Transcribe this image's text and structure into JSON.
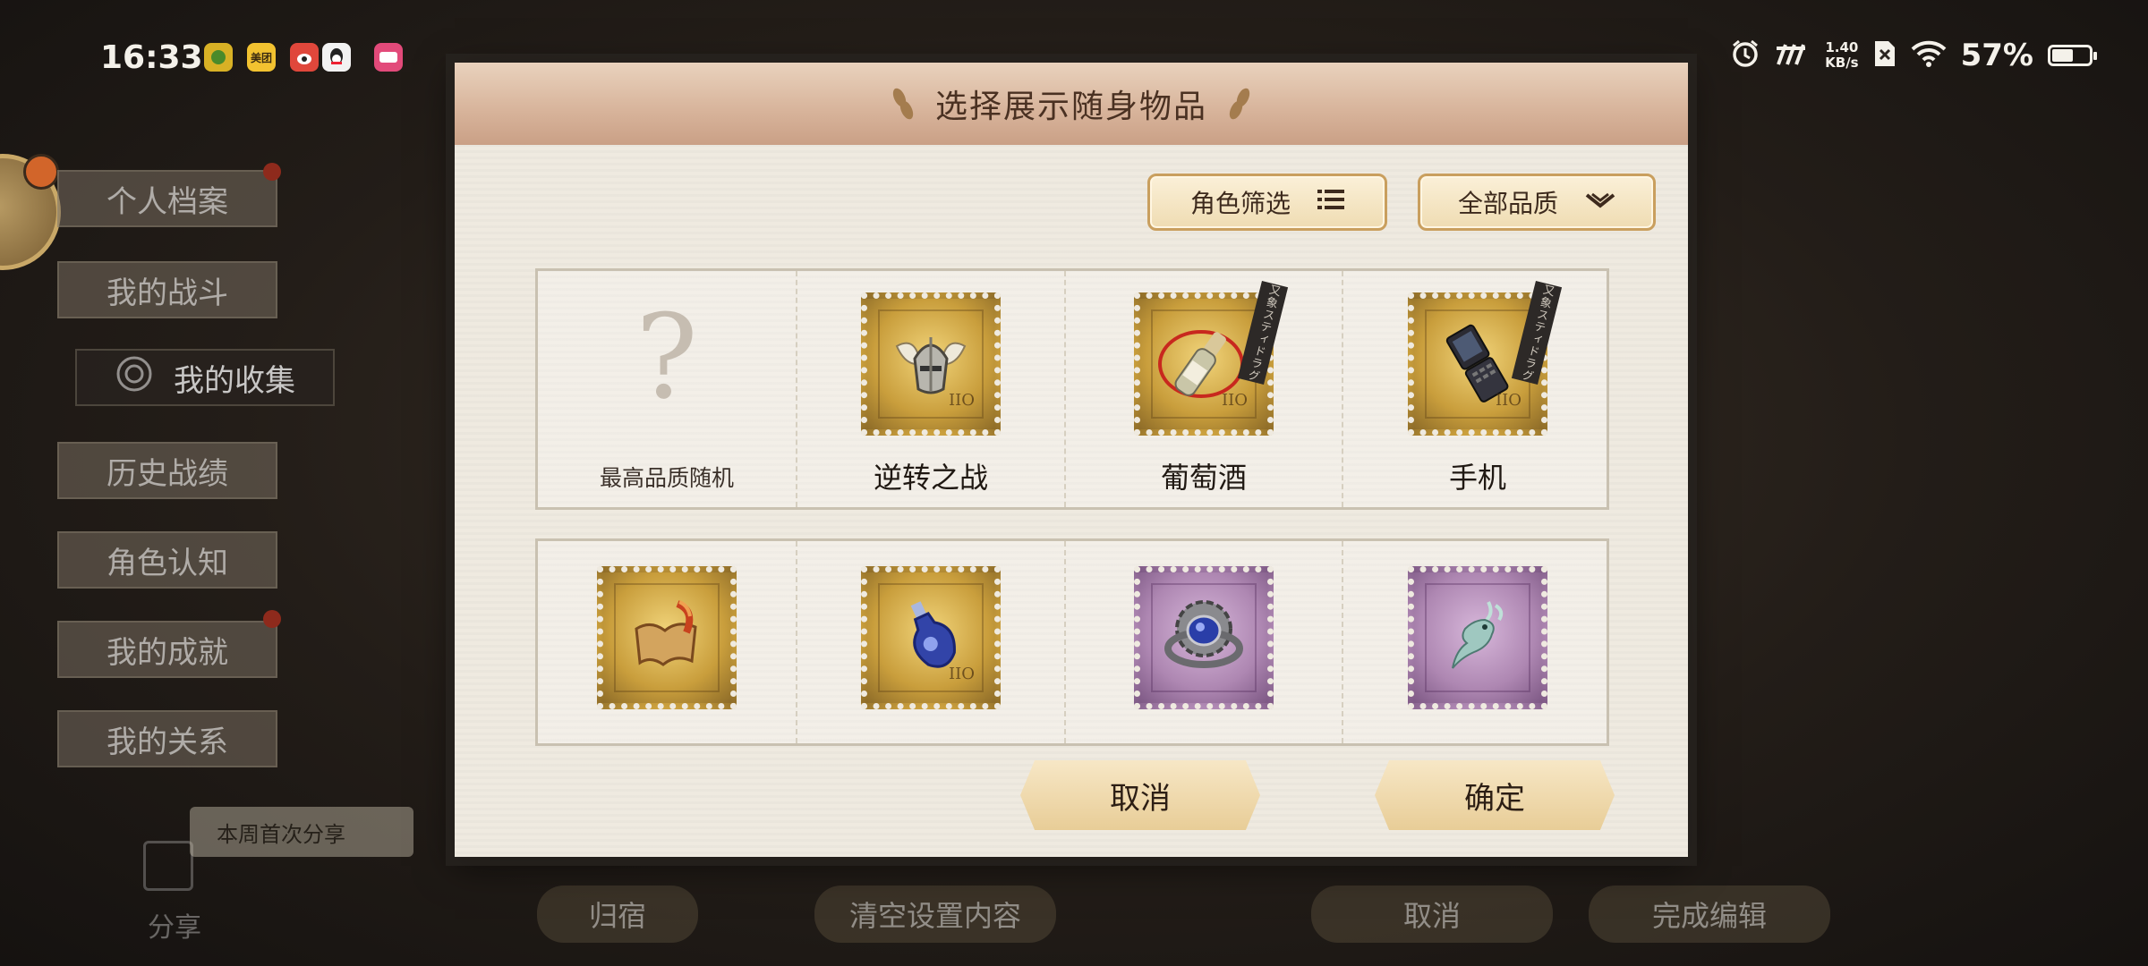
{
  "status_bar": {
    "time": "16:33",
    "apps": [
      {
        "icon": "app-icon-green",
        "label": "",
        "color": "#d8b125"
      },
      {
        "icon": "meituan-icon",
        "label": "美团",
        "color": "#f2c230"
      },
      {
        "icon": "weibo-icon",
        "label": "",
        "color": "#e0473b"
      },
      {
        "icon": "qq-icon",
        "label": "",
        "color": "#f2f2f2"
      },
      {
        "icon": "app-icon-pink",
        "label": "",
        "color": "#e24a7a"
      }
    ],
    "net_speed_value": "1.40",
    "net_speed_unit": "KB/s",
    "battery_percent": "57%",
    "battery_level": 0.57
  },
  "side_menu": {
    "items": [
      {
        "label": "个人档案",
        "badge": true
      },
      {
        "label": "我的战斗",
        "badge": false
      },
      {
        "label": "我的收集",
        "active": true
      },
      {
        "label": "历史战绩",
        "badge": false
      },
      {
        "label": "角色认知",
        "badge": false
      },
      {
        "label": "我的成就",
        "badge": true
      },
      {
        "label": "我的关系",
        "badge": false
      }
    ],
    "share_tag": "本周首次分享",
    "share_label": "分享"
  },
  "bottom_bar": {
    "return_label": "归宿",
    "clear_label": "清空设置内容",
    "cancel_label": "取消",
    "finish_label": "完成编辑"
  },
  "dialog": {
    "title": "选择展示随身物品",
    "filter_role": "角色筛选",
    "filter_quality": "全部品质",
    "items_row1": [
      {
        "label": "最高品质随机",
        "type": "random"
      },
      {
        "label": "逆转之战",
        "stamp": "gold",
        "icon": "winged-helmet-icon",
        "num": "IIO"
      },
      {
        "label": "葡萄酒",
        "stamp": "gold",
        "icon": "wine-bottle-icon",
        "num": "IIO",
        "ribbon": "又象スティドラグ"
      },
      {
        "label": "手机",
        "stamp": "gold",
        "icon": "flip-phone-icon",
        "num": "IIO",
        "ribbon": "又象スティドラグ"
      }
    ],
    "items_row2": [
      {
        "stamp": "gold",
        "icon": "scroll-icon",
        "num": ""
      },
      {
        "stamp": "gold",
        "icon": "potion-bottle-icon",
        "num": "IIO"
      },
      {
        "stamp": "purple",
        "icon": "gear-ring-icon",
        "num": ""
      },
      {
        "stamp": "purple",
        "icon": "spirit-deer-icon",
        "num": ""
      }
    ],
    "cancel": "取消",
    "confirm": "确定"
  }
}
